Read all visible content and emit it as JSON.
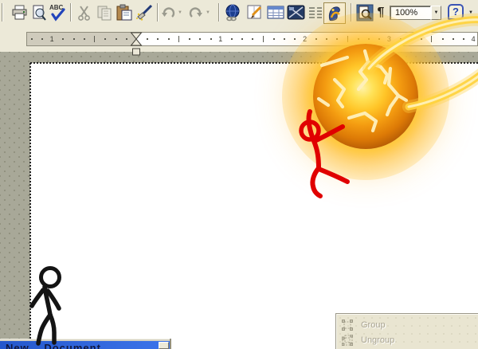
{
  "toolbar": {
    "spellcheck_label": "ABC",
    "pilcrow": "¶",
    "zoom_combo": {
      "value": "100%"
    },
    "help_label": "?",
    "dropdown_glyph": "▼",
    "icon_names": [
      "print",
      "page-preview",
      "spellcheck",
      "cut",
      "copy",
      "paste",
      "format-paintbrush",
      "undo",
      "redo",
      "hyperlink-globe",
      "insert-frame",
      "insert-table",
      "insert-graphic",
      "columns",
      "gallery",
      "zoom",
      "nonprinting-characters",
      "zoom-combobox",
      "help"
    ],
    "disabled_icons": [
      "cut",
      "copy",
      "undo",
      "redo"
    ]
  },
  "ruler": {
    "unit_numbers": [
      "1",
      "2",
      "3",
      "4"
    ],
    "margin_numbers": [
      "1"
    ]
  },
  "canvas": {
    "figures": [
      {
        "name": "black-stick-figure",
        "color": "#141414"
      },
      {
        "name": "red-stick-figure",
        "color": "#e00000"
      },
      {
        "name": "energy-ball",
        "core": "#ffe257",
        "rim": "#8a4206",
        "glow": "#ffc52e",
        "ring": "#ffd23e",
        "cracks": "#fff1bd"
      }
    ]
  },
  "context_menu": {
    "items": [
      {
        "label": "Group",
        "disabled": true
      },
      {
        "label": "Ungroup",
        "disabled": true
      }
    ]
  },
  "bottom_window": {
    "title": "New Document"
  }
}
